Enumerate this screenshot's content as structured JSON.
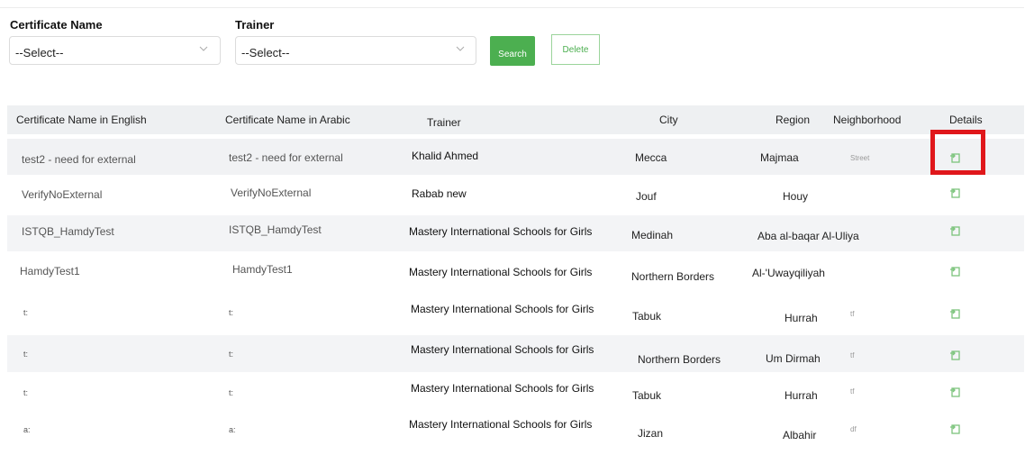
{
  "filters": {
    "certificate": {
      "label": "Certificate Name",
      "value": "--Select--"
    },
    "trainer": {
      "label": "Trainer",
      "value": "--Select--"
    },
    "search_label": "Search",
    "delete_label": "Delete"
  },
  "table": {
    "headers": {
      "name_en": "Certificate Name in English",
      "name_ar": "Certificate Name in Arabic",
      "trainer": "Trainer",
      "city": "City",
      "region": "Region",
      "neighborhood": "Neighborhood",
      "details": "Details"
    },
    "rows": [
      {
        "name_en": "test2 - need for external",
        "name_ar": "test2 - need for external",
        "trainer": "Khalid Ahmed",
        "city": "Mecca",
        "region": "Majmaa",
        "neighborhood": "Street"
      },
      {
        "name_en": "VerifyNoExternal",
        "name_ar": "VerifyNoExternal",
        "trainer": "Rabab new",
        "city": "Jouf",
        "region": "Houy",
        "neighborhood": ""
      },
      {
        "name_en": "ISTQB_HamdyTest",
        "name_ar": "ISTQB_HamdyTest",
        "trainer": "Mastery International Schools for Girls",
        "city": "Medinah",
        "region": "Aba al-baqar Al-Uliya",
        "neighborhood": ""
      },
      {
        "name_en": "HamdyTest1",
        "name_ar": "HamdyTest1",
        "trainer": "Mastery International Schools for Girls",
        "city": "Northern Borders",
        "region": "Al-'Uwayqiliyah",
        "neighborhood": ""
      },
      {
        "name_en": "t:",
        "name_ar": "t:",
        "trainer": "Mastery International Schools for Girls",
        "city": "Tabuk",
        "region": "Hurrah",
        "neighborhood": "tf"
      },
      {
        "name_en": "t:",
        "name_ar": "t:",
        "trainer": "Mastery International Schools for Girls",
        "city": "Northern Borders",
        "region": "Um Dirmah",
        "neighborhood": "tf"
      },
      {
        "name_en": "t:",
        "name_ar": "t:",
        "trainer": "Mastery International Schools for Girls",
        "city": "Tabuk",
        "region": "Hurrah",
        "neighborhood": "tf"
      },
      {
        "name_en": "a:",
        "name_ar": "a:",
        "trainer": "Mastery International Schools for Girls",
        "city": "Jizan",
        "region": "Albahir",
        "neighborhood": "df"
      }
    ]
  },
  "icons": {
    "details": "details-edit-icon",
    "dropdown": "chevron-down-icon"
  },
  "colors": {
    "accent_green": "#4caf50",
    "highlight_red": "#e0171b"
  }
}
